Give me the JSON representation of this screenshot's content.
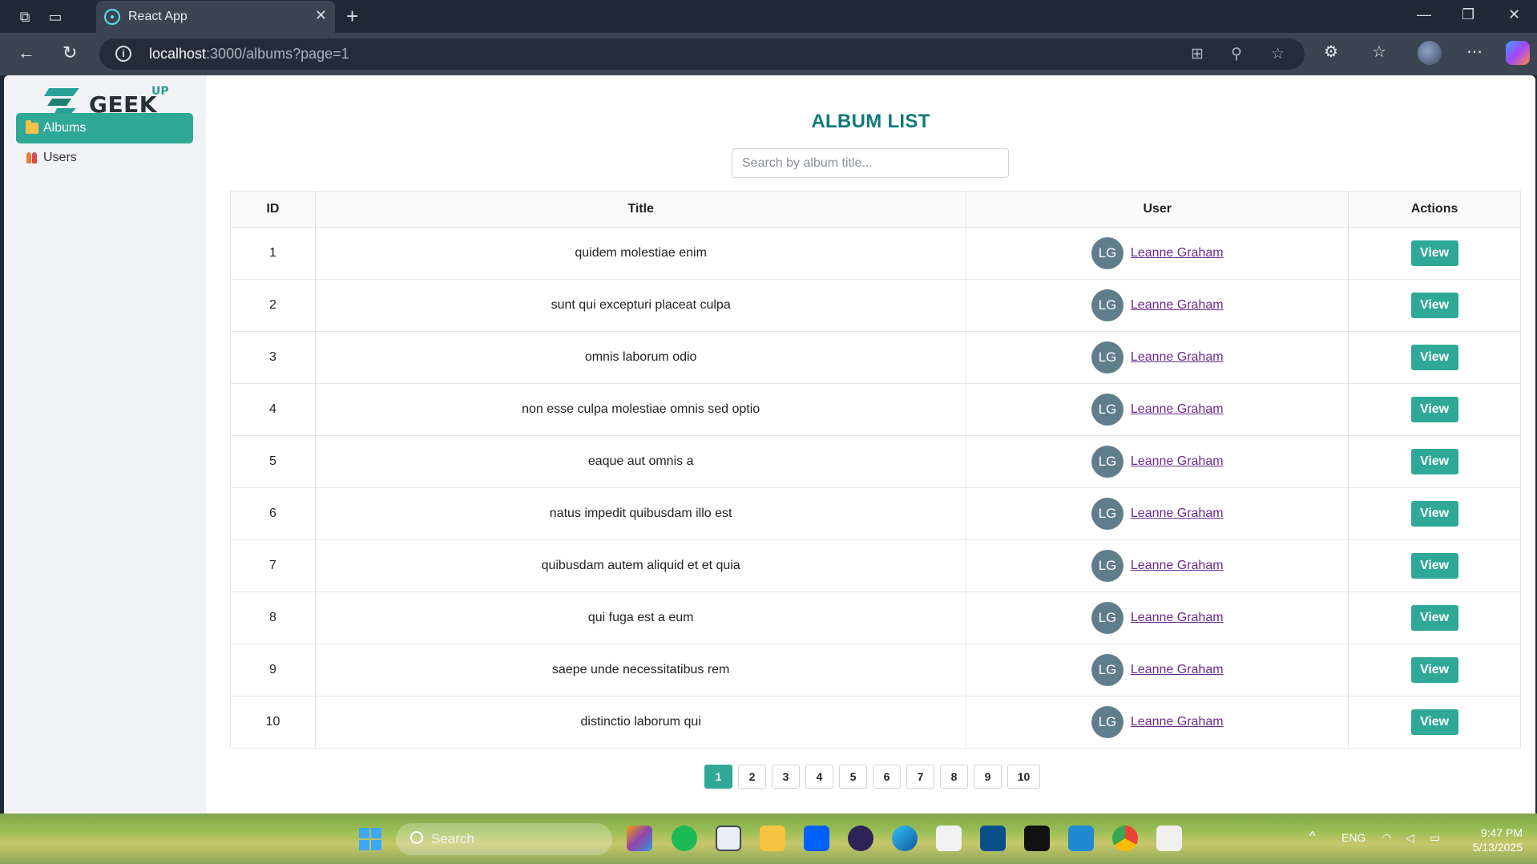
{
  "browser": {
    "tab_title": "React App",
    "url_host": "localhost",
    "url_rest": ":3000/albums?page=1"
  },
  "sidebar": {
    "logo_text": "GEEK",
    "logo_sup": "UP",
    "items": [
      {
        "label": "Albums",
        "icon": "folder-icon",
        "active": true
      },
      {
        "label": "Users",
        "icon": "users-icon",
        "active": false
      }
    ]
  },
  "main": {
    "title": "ALBUM LIST",
    "search_placeholder": "Search by album title...",
    "columns": [
      "ID",
      "Title",
      "User",
      "Actions"
    ],
    "rows": [
      {
        "id": "1",
        "title": "quidem molestiae enim",
        "initials": "LG",
        "user": "Leanne Graham",
        "action": "View"
      },
      {
        "id": "2",
        "title": "sunt qui excepturi placeat culpa",
        "initials": "LG",
        "user": "Leanne Graham",
        "action": "View"
      },
      {
        "id": "3",
        "title": "omnis laborum odio",
        "initials": "LG",
        "user": "Leanne Graham",
        "action": "View"
      },
      {
        "id": "4",
        "title": "non esse culpa molestiae omnis sed optio",
        "initials": "LG",
        "user": "Leanne Graham",
        "action": "View"
      },
      {
        "id": "5",
        "title": "eaque aut omnis a",
        "initials": "LG",
        "user": "Leanne Graham",
        "action": "View"
      },
      {
        "id": "6",
        "title": "natus impedit quibusdam illo est",
        "initials": "LG",
        "user": "Leanne Graham",
        "action": "View"
      },
      {
        "id": "7",
        "title": "quibusdam autem aliquid et et quia",
        "initials": "LG",
        "user": "Leanne Graham",
        "action": "View"
      },
      {
        "id": "8",
        "title": "qui fuga est a eum",
        "initials": "LG",
        "user": "Leanne Graham",
        "action": "View"
      },
      {
        "id": "9",
        "title": "saepe unde necessitatibus rem",
        "initials": "LG",
        "user": "Leanne Graham",
        "action": "View"
      },
      {
        "id": "10",
        "title": "distinctio laborum qui",
        "initials": "LG",
        "user": "Leanne Graham",
        "action": "View"
      }
    ],
    "pages": [
      "1",
      "2",
      "3",
      "4",
      "5",
      "6",
      "7",
      "8",
      "9",
      "10"
    ],
    "current_page": "1"
  },
  "taskbar": {
    "search_label": "Search",
    "language": "ENG",
    "time": "9:47 PM",
    "date": "5/13/2025"
  },
  "colors": {
    "accent": "#2fa898",
    "title": "#13797a",
    "avatar": "#607d8b",
    "link": "#6b2a8f"
  }
}
